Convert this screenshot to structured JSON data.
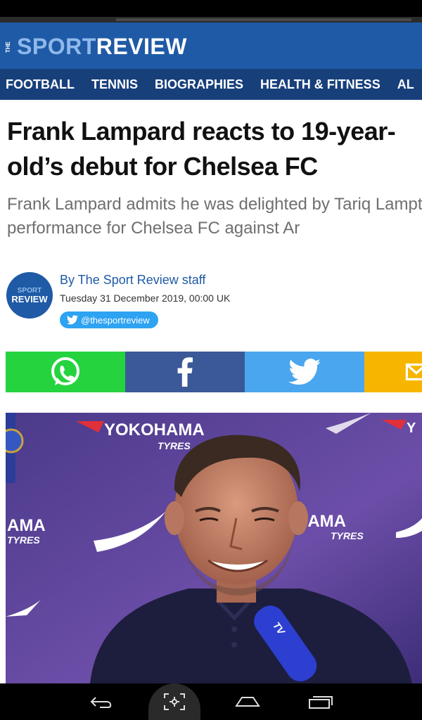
{
  "site": {
    "logo_the": "THE",
    "logo_sport": "SPORT",
    "logo_review": "REVIEW"
  },
  "nav": {
    "items": [
      "FOOTBALL",
      "TENNIS",
      "BIOGRAPHIES",
      "HEALTH & FITNESS",
      "AL"
    ]
  },
  "article": {
    "headline": "Frank Lampard reacts to 19-year-old’s debut for Chelsea FC",
    "standfirst": "Frank Lampard admits he was delighted by Tariq Lamptey's performance for Chelsea FC against Ar",
    "author_avatar_top": "SPORT",
    "author_avatar_bottom": "REVIEW",
    "byline": "By The Sport Review staff",
    "date": "Tuesday 31 December 2019, 00:00 UK",
    "twitter_handle": "@thesportreview"
  },
  "share": {
    "items": [
      {
        "name": "whatsapp",
        "icon": "whatsapp-icon",
        "color": "#25d33f"
      },
      {
        "name": "facebook",
        "icon": "facebook-icon",
        "color": "#3b5998"
      },
      {
        "name": "twitter",
        "icon": "twitter-icon",
        "color": "#4aa6ee"
      },
      {
        "name": "email",
        "icon": "email-icon",
        "color": "#f7b500"
      }
    ]
  },
  "photo": {
    "backdrop_text_1": "YOKOHAMA",
    "backdrop_text_2": "TYRES",
    "backdrop_text_3": "AMA",
    "backdrop_text_4": "TYRES",
    "backdrop_text_5": "HAMA",
    "backdrop_text_6": "TYRES",
    "mic_text": "TV"
  },
  "colors": {
    "masthead": "#1f5aa6",
    "nav": "#173f7a",
    "logo_sport": "#8fb9ea"
  },
  "system_nav": {
    "icons": [
      "back-icon",
      "screenshot-icon",
      "home-icon",
      "recent-apps-icon"
    ]
  }
}
